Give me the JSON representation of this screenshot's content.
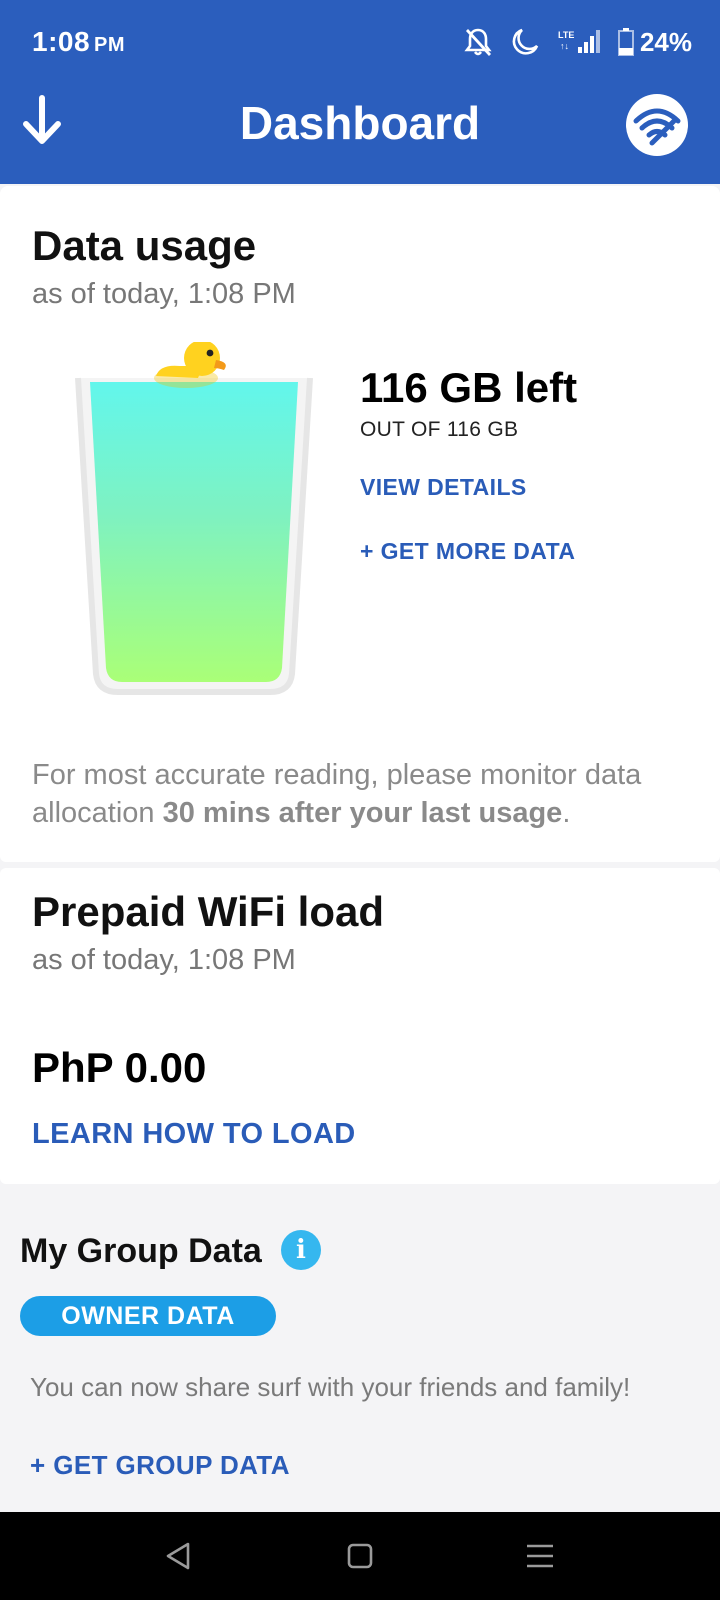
{
  "status": {
    "time": "1:08",
    "ampm": "PM",
    "battery": "24%",
    "icons": [
      "notifications-off-icon",
      "moon-icon",
      "lte-signal-icon",
      "battery-icon"
    ]
  },
  "appbar": {
    "title": "Dashboard",
    "left_icon": "arrow-down-icon",
    "right_icon": "wifi-logo-icon",
    "color": "#2b5ebd"
  },
  "data_usage": {
    "title": "Data usage",
    "subtitle": "as of today, 1:08 PM",
    "left": "116 GB left",
    "total": "OUT OF 116 GB",
    "view_details": "VIEW DETAILS",
    "get_more": "+ GET MORE DATA",
    "fill_fraction": 1.0,
    "note_prefix": "For most accurate reading, please monitor data allocation ",
    "note_bold": "30 mins after your last usage",
    "note_suffix": "."
  },
  "wifi_load": {
    "title": "Prepaid WiFi load",
    "subtitle": "as of today, 1:08 PM",
    "amount": "PhP 0.00",
    "learn": "LEARN HOW TO LOAD"
  },
  "group_data": {
    "title": "My Group Data",
    "info_icon": "i",
    "owner_badge": "OWNER DATA",
    "description": "You can now share surf with your friends and family!",
    "get_group": "+ GET GROUP DATA"
  },
  "navbar": {
    "icons": [
      "back-icon",
      "home-icon",
      "menu-icon"
    ]
  },
  "colors": {
    "accent": "#2a5cb8",
    "badge": "#1c9ee6",
    "info": "#35b7ef"
  }
}
